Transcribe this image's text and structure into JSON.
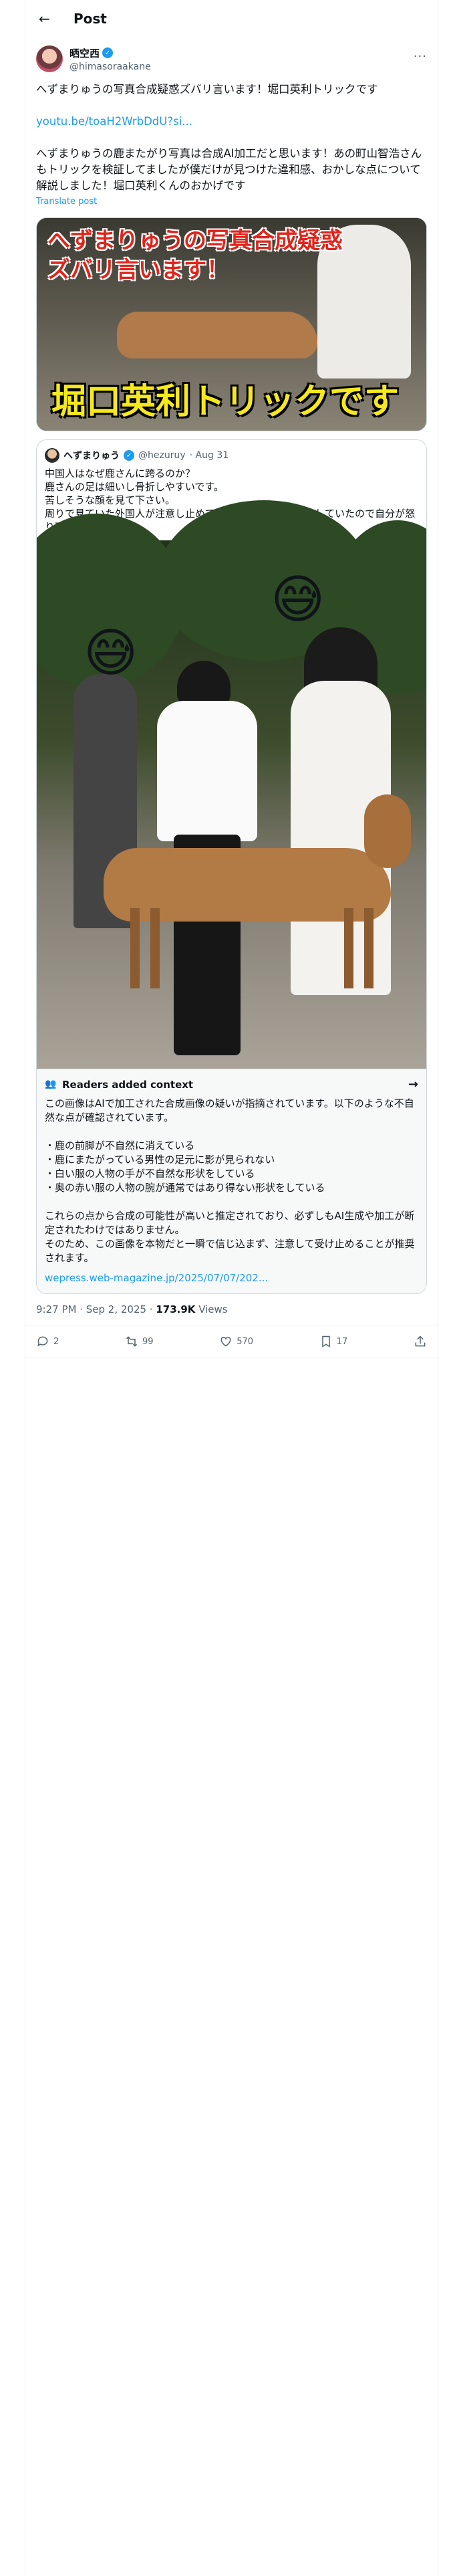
{
  "header": {
    "title": "Post"
  },
  "author": {
    "name": "晒空西",
    "handle": "@himasoraakane"
  },
  "post": {
    "line1": "へずまりゅうの写真合成疑惑ズバリ言います！堀口英利トリックです",
    "link": "youtu.be/toaH2WrbDdU?si...",
    "line2": "へずまりゅうの鹿またがり写真は合成AI加工だと思います！あの町山智浩さんもトリックを検証してましたが僕だけが見つけた違和感、おかしな点について解説しました！堀口英利くんのおかげです",
    "translate": "Translate post",
    "thumb_top_line1": "へずまりゅうの写真合成疑惑",
    "thumb_top_line2": "ズバリ言います！",
    "thumb_bottom": "堀口英利トリックです"
  },
  "quote": {
    "name": "へずまりゅう",
    "handle": "@hezuruy",
    "date": "· Aug 31",
    "text": "中国人はなぜ鹿さんに跨るのか？\n鹿さんの足は細いし骨折しやすいです。\n苦しそうな顔を見て下さい。\n周りで見ていた外国人が注意し止めてくれましたが言い訳をしていたので自分が怒り理解させました。..."
  },
  "context": {
    "title": "Readers added context",
    "p1": "この画像はAIで加工された合成画像の疑いが指摘されています。以下のような不自然な点が確認されています。",
    "bullets": [
      "・鹿の前脚が不自然に消えている",
      "・鹿にまたがっている男性の足元に影が見られない",
      "・白い服の人物の手が不自然な形状をしている",
      "・奥の赤い服の人物の腕が通常ではあり得ない形状をしている"
    ],
    "p2": "これらの点から合成の可能性が高いと推定されており、必ずしもAI生成や加工が断定されたわけではありません。\nそのため、この画像を本物だと一瞬で信じ込まず、注意して受け止めることが推奨されます。",
    "link": "wepress.web-magazine.jp/2025/07/07/202..."
  },
  "meta": {
    "time": "9:27 PM · Sep 2, 2025 · ",
    "views": "173.9K",
    "views_label": " Views"
  },
  "actions": {
    "replies": "2",
    "reposts": "99",
    "likes": "570",
    "bookmarks": "17"
  }
}
